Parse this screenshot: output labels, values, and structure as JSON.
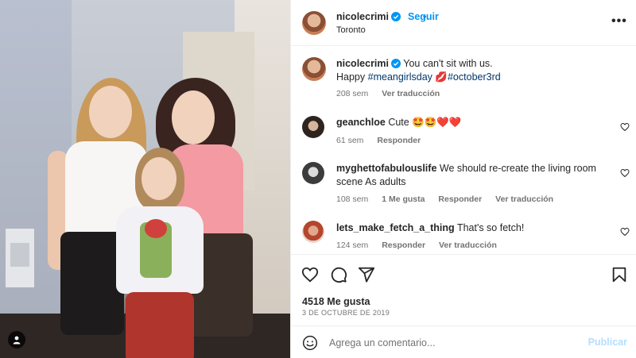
{
  "post": {
    "owner": "nicolecrimi",
    "follow_label": "Seguir",
    "dot": "•",
    "location": "Toronto",
    "more_label": "•••"
  },
  "caption": {
    "username": "nicolecrimi",
    "text_line1": "You can't sit with us.",
    "text_line2_prefix": "Happy",
    "hashtag1": "#meangirlsday",
    "hashtag2": "#october3rd",
    "emoji": "💋",
    "time": "208 sem",
    "translate": "Ver traducción"
  },
  "comments": [
    {
      "username": "geanchloe",
      "text": "Cute 🤩🤩❤️❤️",
      "time": "61 sem",
      "reply": "Responder"
    },
    {
      "username": "myghettofabulouslife",
      "text_line1": "We should re-create the living room",
      "text_line2": "scene As adults",
      "time": "108 sem",
      "likes": "1 Me gusta",
      "reply": "Responder",
      "translate": "Ver traducción"
    },
    {
      "username": "lets_make_fetch_a_thing",
      "text": "That's so fetch!",
      "time": "124 sem",
      "reply": "Responder",
      "translate": "Ver traducción"
    }
  ],
  "footer": {
    "likes": "4518 Me gusta",
    "date": "3 DE OCTUBRE DE 2019",
    "comment_placeholder": "Agrega un comentario...",
    "publish_label": "Publicar"
  },
  "icons": {
    "verified": "verified-badge-icon",
    "like": "heart-icon",
    "comment": "comment-icon",
    "share": "share-icon",
    "save": "bookmark-icon",
    "emoji": "emoji-icon",
    "tags": "user-tag-icon"
  },
  "colors": {
    "accent": "#0095f6",
    "verified": "#0095f6",
    "hashtag": "#00376b",
    "muted": "#737373",
    "publish_disabled": "#b2dffc"
  }
}
